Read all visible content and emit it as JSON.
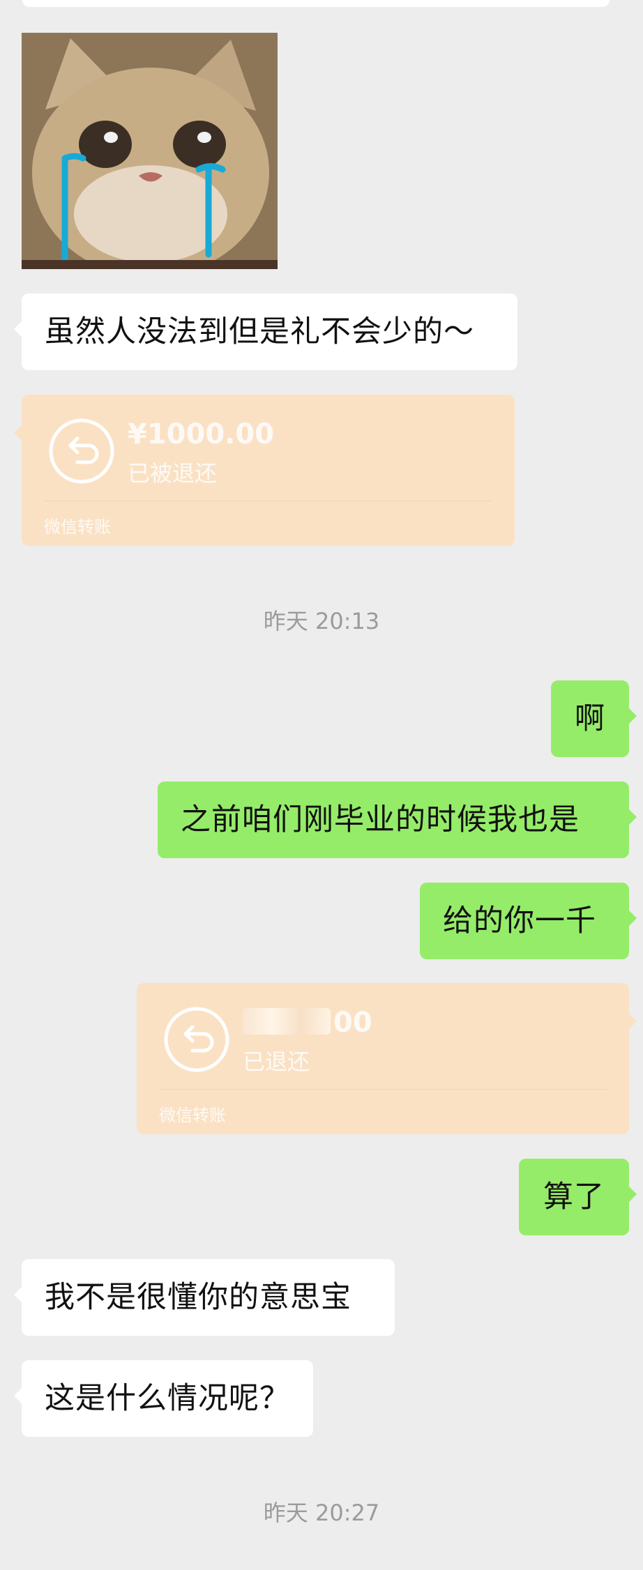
{
  "messages": {
    "m1": "虽然人没法到但是礼不会少的～",
    "m2": "啊",
    "m3": "之前咱们刚毕业的时候我也是",
    "m4": "给的你一千",
    "m5": "算了",
    "m6": "我不是很懂你的意思宝",
    "m7": "这是什么情况呢？"
  },
  "transfer1": {
    "amount": "¥1000.00",
    "status": "已被退还",
    "label": "微信转账"
  },
  "transfer2": {
    "amount_visible": "00",
    "status": "已退还",
    "label": "微信转账"
  },
  "timestamps": {
    "t1": "昨天 20:13",
    "t2": "昨天 20:27"
  },
  "colors": {
    "background": "#ededed",
    "received_bubble": "#ffffff",
    "sent_bubble": "#95ec69",
    "transfer_card": "#fbe1c4",
    "timestamp_text": "#9b9b9b"
  }
}
